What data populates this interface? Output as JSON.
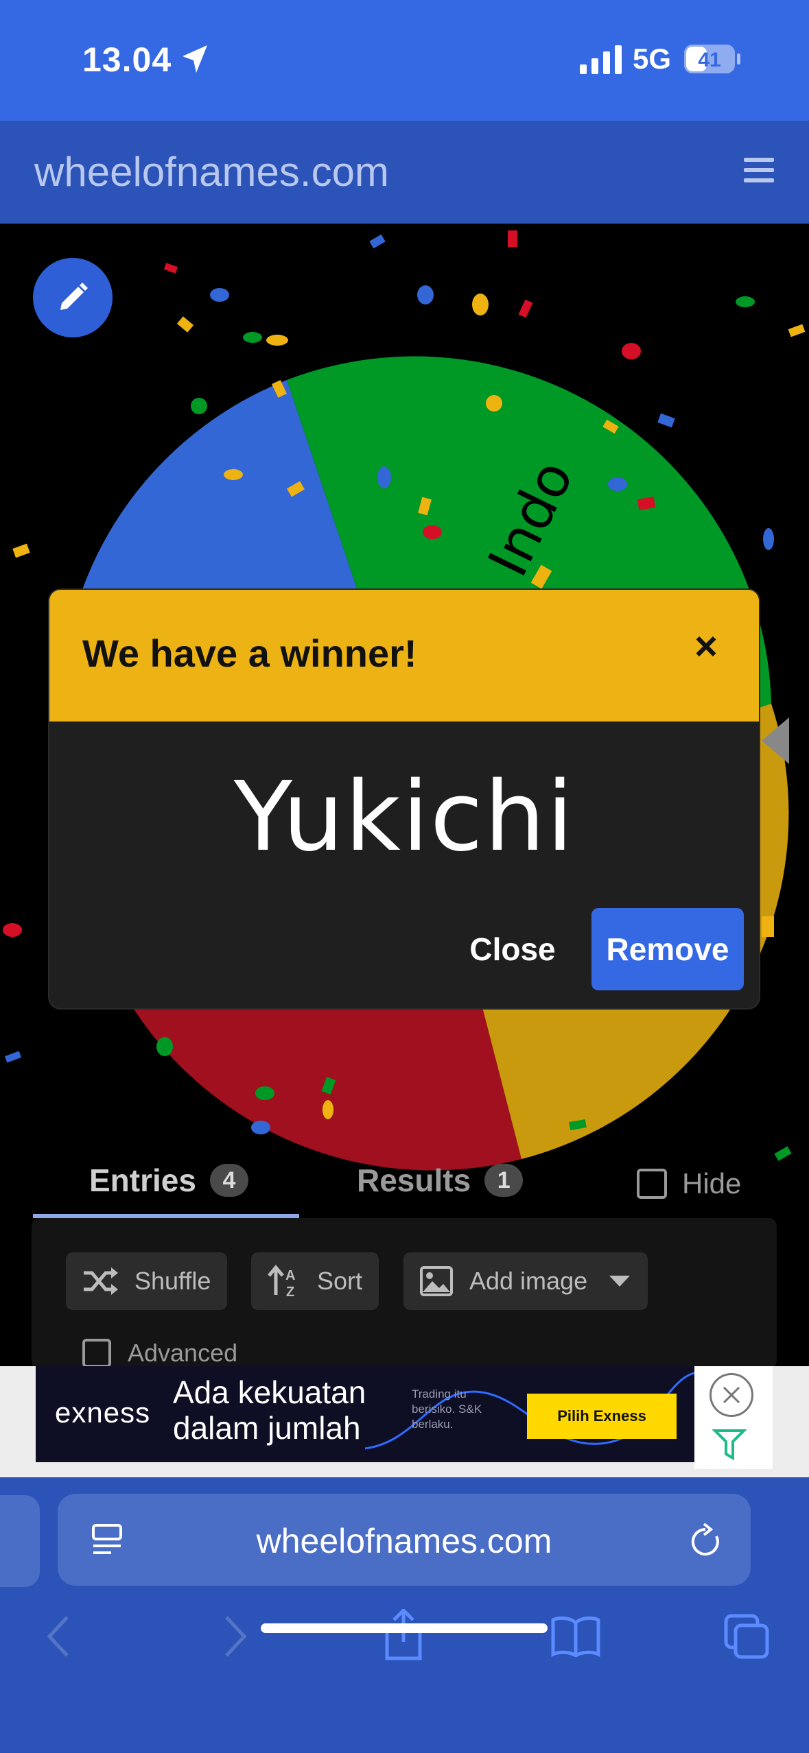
{
  "status_bar": {
    "time": "13.04",
    "network": "5G",
    "battery": "41",
    "icons": [
      "location-arrow-icon",
      "cellular-signal-icon",
      "battery-icon"
    ]
  },
  "site_header": {
    "title": "wheelofnames.com",
    "menu_icon": "hamburger-menu-icon"
  },
  "wheel": {
    "visible_labels": [
      "Indo"
    ],
    "segment_colors": [
      "#3367D6",
      "#009925",
      "#D50F25",
      "#EEB211"
    ],
    "edit_icon": "pencil-icon"
  },
  "dialog": {
    "title": "We have a winner!",
    "close_symbol": "×",
    "winner": "Yukichi",
    "close_label": "Close",
    "remove_label": "Remove",
    "header_color": "#EDB314",
    "accent_color": "#3568E3"
  },
  "tabs": {
    "entries_label": "Entries",
    "entries_count": "4",
    "results_label": "Results",
    "results_count": "1",
    "hide_label": "Hide"
  },
  "entries_toolbar": {
    "shuffle_label": "Shuffle",
    "sort_label": "Sort",
    "add_image_label": "Add image",
    "advanced_label": "Advanced"
  },
  "ad": {
    "brand": "exness",
    "headline_line1": "Ada kekuatan",
    "headline_line2": "dalam jumlah",
    "small_line1": "Trading itu",
    "small_line2": "berisiko. S&K",
    "small_line3": "berlaku.",
    "cta": "Pilih Exness"
  },
  "browser": {
    "url": "wheelofnames.com",
    "nav_icons": [
      "back-icon",
      "forward-icon",
      "share-icon",
      "bookmarks-icon",
      "tabs-icon"
    ]
  }
}
